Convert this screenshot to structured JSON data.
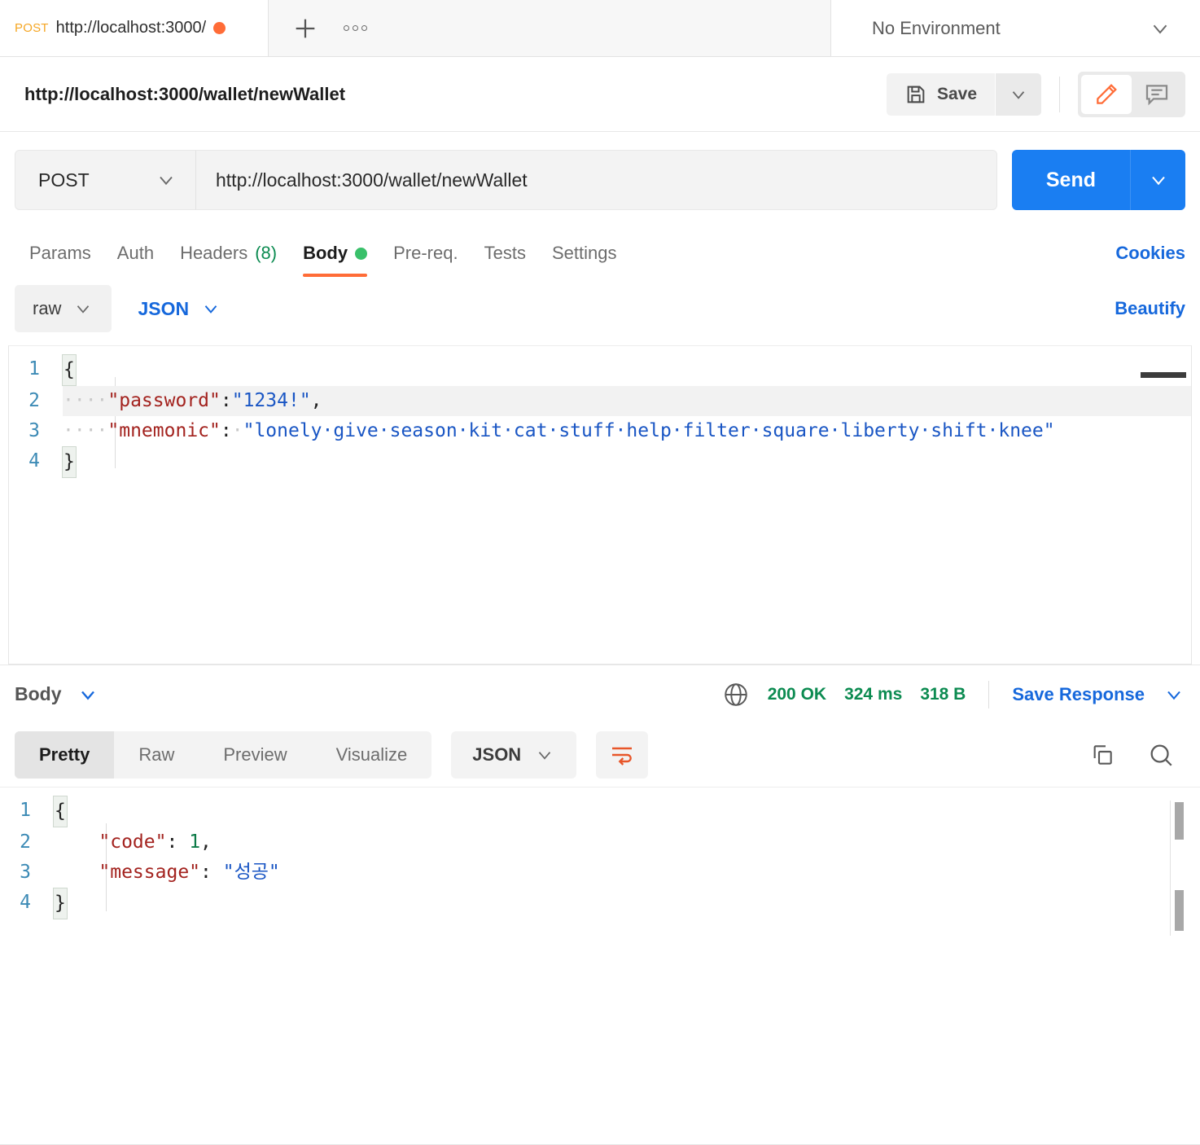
{
  "tab_bar": {
    "active_tab": {
      "method": "POST",
      "url": "http://localhost:3000/",
      "unsaved": true
    },
    "new_tab_icon": "plus-icon",
    "more_icon": "ellipsis-icon",
    "environment": {
      "label": "No Environment",
      "caret": "chevron-down-icon"
    }
  },
  "request_header": {
    "title": "http://localhost:3000/wallet/newWallet",
    "save_label": "Save",
    "save_icon": "floppy-disk-icon",
    "save_caret": "chevron-down-icon",
    "edit_icon": "pencil-icon",
    "comment_icon": "comment-icon",
    "accent_color": "#ff6c37"
  },
  "url_bar": {
    "method": "POST",
    "method_caret": "chevron-down-icon",
    "url": "http://localhost:3000/wallet/newWallet",
    "send_label": "Send",
    "send_caret": "chevron-down-icon",
    "send_color": "#1a7ef2"
  },
  "request_tabs": {
    "items": [
      {
        "label": "Params",
        "active": false
      },
      {
        "label": "Auth",
        "active": false
      },
      {
        "label": "Headers",
        "count": "(8)",
        "active": false
      },
      {
        "label": "Body",
        "active": true,
        "dot": true
      },
      {
        "label": "Pre-req.",
        "active": false
      },
      {
        "label": "Tests",
        "active": false
      },
      {
        "label": "Settings",
        "active": false
      }
    ],
    "cookies_label": "Cookies"
  },
  "body_type_row": {
    "mode": "raw",
    "mode_caret": "chevron-down-icon",
    "format": "JSON",
    "format_caret": "chevron-down-icon",
    "beautify_label": "Beautify"
  },
  "request_body": {
    "language": "json",
    "lines": [
      {
        "no": "1",
        "tokens": [
          {
            "t": "{",
            "c": "brace"
          }
        ]
      },
      {
        "no": "2",
        "highlighted": true,
        "tokens": [
          {
            "t": "····",
            "c": "ws"
          },
          {
            "t": "\"password\"",
            "c": "key"
          },
          {
            "t": ":",
            "c": "punc"
          },
          {
            "t": "\"1234!\"",
            "c": "str"
          },
          {
            "t": ",",
            "c": "punc"
          }
        ]
      },
      {
        "no": "3",
        "tokens": [
          {
            "t": "····",
            "c": "ws"
          },
          {
            "t": "\"mnemonic\"",
            "c": "key"
          },
          {
            "t": ":",
            "c": "punc"
          },
          {
            "t": "·",
            "c": "ws"
          },
          {
            "t": "\"lonely·give·season·kit·cat·stuff·help·filter·square·liberty·shift·knee\"",
            "c": "str"
          }
        ]
      },
      {
        "no": "4",
        "tokens": [
          {
            "t": "}",
            "c": "brace"
          }
        ]
      }
    ]
  },
  "response_meta": {
    "body_label": "Body",
    "body_caret": "chevron-down-icon",
    "globe_icon": "globe-icon",
    "status": "200 OK",
    "time": "324 ms",
    "size": "318 B",
    "save_response_label": "Save Response",
    "save_response_caret": "chevron-down-icon",
    "status_color": "#0c8b51"
  },
  "response_tabs": {
    "items": [
      {
        "label": "Pretty",
        "active": true
      },
      {
        "label": "Raw",
        "active": false
      },
      {
        "label": "Preview",
        "active": false
      },
      {
        "label": "Visualize",
        "active": false
      }
    ],
    "format": "JSON",
    "format_caret": "chevron-down-icon",
    "wrap_icon": "word-wrap-icon",
    "copy_icon": "copy-icon",
    "search_icon": "search-icon"
  },
  "response_body": {
    "language": "json",
    "lines": [
      {
        "no": "1",
        "tokens": [
          {
            "t": "{",
            "c": "brace"
          }
        ]
      },
      {
        "no": "2",
        "tokens": [
          {
            "t": "    ",
            "c": "plain"
          },
          {
            "t": "\"code\"",
            "c": "key"
          },
          {
            "t": ": ",
            "c": "punc"
          },
          {
            "t": "1",
            "c": "num"
          },
          {
            "t": ",",
            "c": "punc"
          }
        ]
      },
      {
        "no": "3",
        "tokens": [
          {
            "t": "    ",
            "c": "plain"
          },
          {
            "t": "\"message\"",
            "c": "key"
          },
          {
            "t": ": ",
            "c": "punc"
          },
          {
            "t": "\"성공\"",
            "c": "str"
          }
        ]
      },
      {
        "no": "4",
        "tokens": [
          {
            "t": "}",
            "c": "brace"
          }
        ]
      }
    ]
  }
}
